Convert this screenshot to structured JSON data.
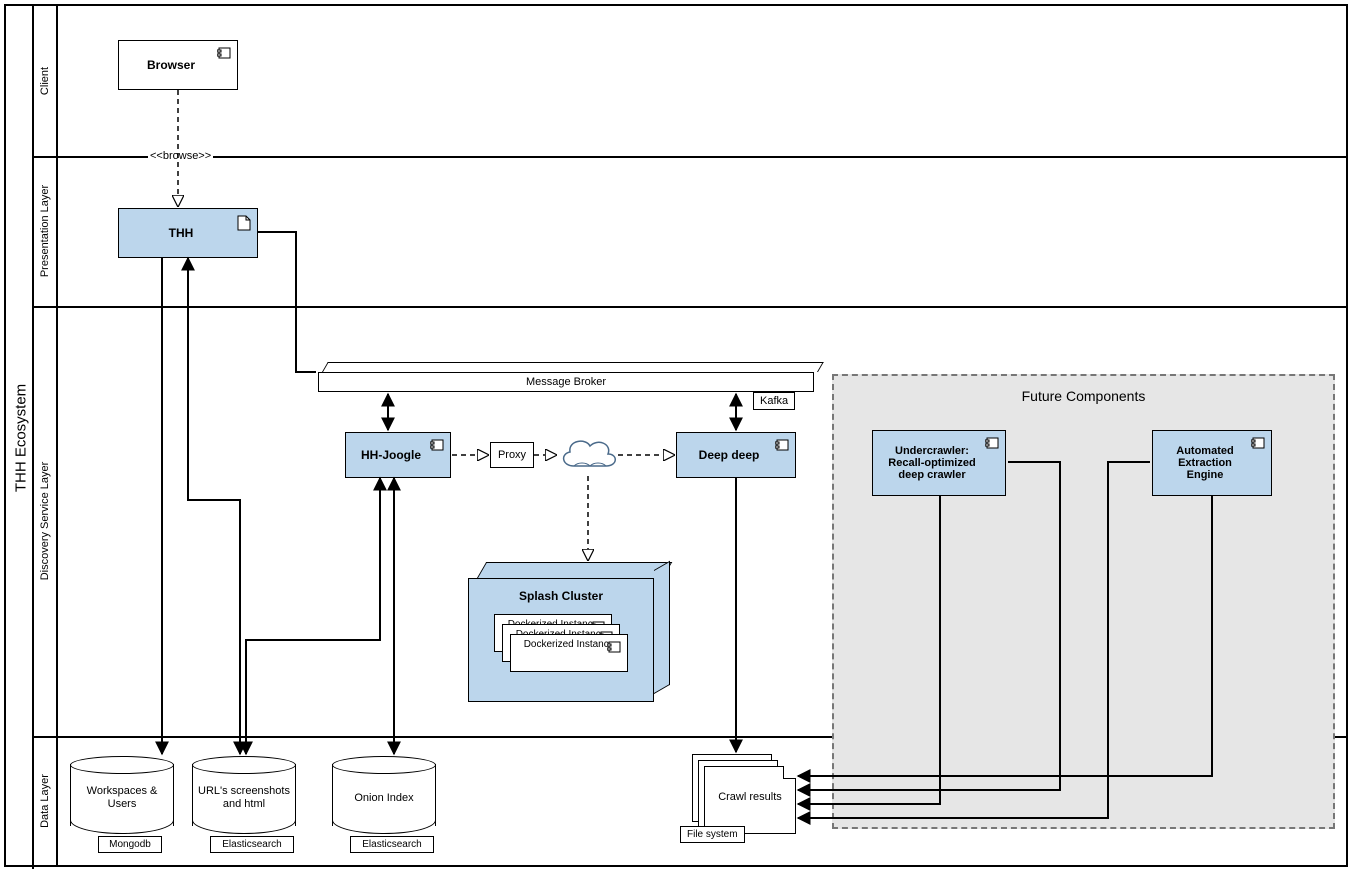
{
  "diagram_title": "THH Ecosystem",
  "lanes": {
    "client": "Client",
    "presentation": "Presentation Layer",
    "discovery": "Discovery Service Layer",
    "data": "Data Layer"
  },
  "components": {
    "browser": "Browser",
    "thh": "THH",
    "message_broker": "Message Broker",
    "kafka": "Kafka",
    "hh_joogle": "HH-Joogle",
    "proxy": "Proxy",
    "deep_deep": "Deep deep",
    "splash_cluster": "Splash Cluster",
    "docker_instance": "Dockerized Instance",
    "future_title": "Future Components",
    "undercrawler": "Undercrawler: Recall-optimized deep crawler",
    "extraction_engine": "Automated Extraction Engine"
  },
  "datastores": {
    "workspaces": {
      "label": "Workspaces  & Users",
      "tech": "Mongodb"
    },
    "urls": {
      "label": "URL's screenshots and html",
      "tech": "Elasticsearch"
    },
    "onion": {
      "label": "Onion Index",
      "tech": "Elasticsearch"
    },
    "crawl_results": {
      "label": "Crawl results",
      "tech": "File system"
    }
  },
  "edges": {
    "browse": "<<browse>>"
  }
}
